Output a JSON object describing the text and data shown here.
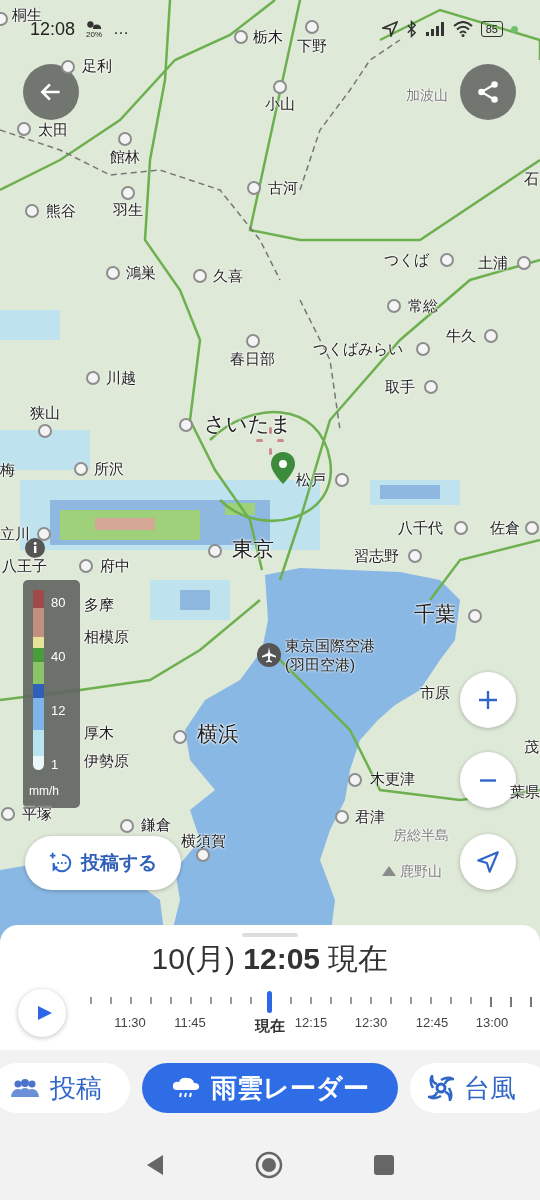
{
  "status_bar": {
    "time": "12:08",
    "weather_text": "20%",
    "more": "…",
    "battery": "85"
  },
  "map": {
    "places": [
      {
        "name": "桐生",
        "kind": "city"
      },
      {
        "name": "栃木",
        "kind": "city"
      },
      {
        "name": "下野",
        "kind": "city"
      },
      {
        "name": "足利",
        "kind": "city"
      },
      {
        "name": "小山",
        "kind": "city"
      },
      {
        "name": "加波山",
        "kind": "hint"
      },
      {
        "name": "太田",
        "kind": "city"
      },
      {
        "name": "館林",
        "kind": "city"
      },
      {
        "name": "古河",
        "kind": "city"
      },
      {
        "name": "石",
        "kind": "area"
      },
      {
        "name": "熊谷",
        "kind": "city"
      },
      {
        "name": "羽生",
        "kind": "city"
      },
      {
        "name": "鴻巣",
        "kind": "city"
      },
      {
        "name": "久喜",
        "kind": "city"
      },
      {
        "name": "つくば",
        "kind": "city"
      },
      {
        "name": "土浦",
        "kind": "city"
      },
      {
        "name": "常総",
        "kind": "city"
      },
      {
        "name": "春日部",
        "kind": "city"
      },
      {
        "name": "つくばみらい",
        "kind": "city"
      },
      {
        "name": "牛久",
        "kind": "city"
      },
      {
        "name": "川越",
        "kind": "city"
      },
      {
        "name": "取手",
        "kind": "city"
      },
      {
        "name": "狭山",
        "kind": "city"
      },
      {
        "name": "さいたま",
        "kind": "major"
      },
      {
        "name": "梅",
        "kind": "area"
      },
      {
        "name": "所沢",
        "kind": "city"
      },
      {
        "name": "松戸",
        "kind": "city"
      },
      {
        "name": "立川",
        "kind": "city"
      },
      {
        "name": "八千代",
        "kind": "city"
      },
      {
        "name": "佐倉",
        "kind": "city"
      },
      {
        "name": "八王子",
        "kind": "area"
      },
      {
        "name": "府中",
        "kind": "city"
      },
      {
        "name": "東京",
        "kind": "major"
      },
      {
        "name": "習志野",
        "kind": "city"
      },
      {
        "name": "多摩",
        "kind": "area"
      },
      {
        "name": "千葉",
        "kind": "major"
      },
      {
        "name": "相模原",
        "kind": "area"
      },
      {
        "name": "市原",
        "kind": "area"
      },
      {
        "name": "厚木",
        "kind": "area"
      },
      {
        "name": "横浜",
        "kind": "major"
      },
      {
        "name": "茂",
        "kind": "area"
      },
      {
        "name": "伊勢原",
        "kind": "area"
      },
      {
        "name": "木更津",
        "kind": "city"
      },
      {
        "name": "葉県",
        "kind": "area"
      },
      {
        "name": "平塚",
        "kind": "city"
      },
      {
        "name": "鎌倉",
        "kind": "city"
      },
      {
        "name": "君津",
        "kind": "city"
      },
      {
        "name": "横須賀",
        "kind": "city"
      },
      {
        "name": "房総半島",
        "kind": "hint"
      },
      {
        "name": "鹿野山",
        "kind": "mountain"
      }
    ],
    "airport": {
      "lines": [
        "東京国際空港",
        "(羽田空港)"
      ]
    },
    "legend": {
      "ticks": [
        "80",
        "40",
        "12",
        "1"
      ],
      "unit": "mm/h"
    }
  },
  "post_button": {
    "label": "投稿する"
  },
  "time_panel": {
    "title": "10(月) **12:05** 現在",
    "level": 0.4,
    "labels": [
      {
        "text": "11:30",
        "kind": "time"
      },
      {
        "text": "11:45",
        "kind": "time"
      },
      {
        "text": "現在",
        "kind": "now"
      },
      {
        "text": "12:15",
        "kind": "time"
      },
      {
        "text": "12:30",
        "kind": "time"
      },
      {
        "text": "12:45",
        "kind": "time"
      },
      {
        "text": "13:00",
        "kind": "time"
      }
    ]
  },
  "tabs": [
    {
      "label": "投稿",
      "kind": "posts",
      "selected": false
    },
    {
      "label": "雨雲レーダー",
      "kind": "radar",
      "selected": true
    },
    {
      "label": "台風",
      "kind": "typhoon",
      "selected": false
    }
  ]
}
